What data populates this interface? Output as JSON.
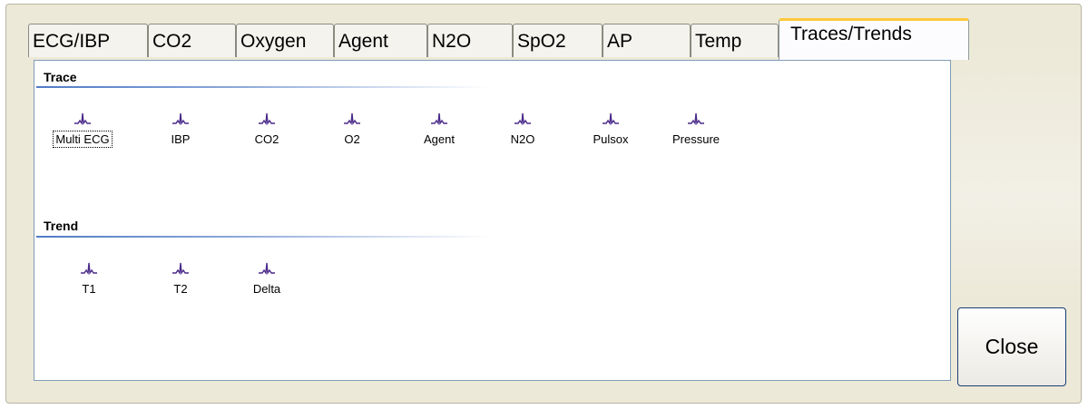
{
  "tabs": [
    {
      "label": "ECG/IBP",
      "active": false
    },
    {
      "label": "CO2",
      "active": false
    },
    {
      "label": "Oxygen",
      "active": false
    },
    {
      "label": "Agent",
      "active": false
    },
    {
      "label": "N2O",
      "active": false
    },
    {
      "label": "SpO2",
      "active": false
    },
    {
      "label": "AP",
      "active": false
    },
    {
      "label": "Temp",
      "active": false
    },
    {
      "label": "Traces/Trends",
      "active": true
    }
  ],
  "trace": {
    "title": "Trace",
    "items": [
      {
        "label": "Multi ECG",
        "icon": "waveform-icon",
        "focused": true
      },
      {
        "label": "IBP",
        "icon": "waveform-icon"
      },
      {
        "label": "CO2",
        "icon": "waveform-icon"
      },
      {
        "label": "O2",
        "icon": "waveform-icon"
      },
      {
        "label": "Agent",
        "icon": "waveform-icon"
      },
      {
        "label": "N2O",
        "icon": "waveform-icon"
      },
      {
        "label": "Pulsox",
        "icon": "waveform-icon"
      },
      {
        "label": "Pressure",
        "icon": "waveform-icon"
      }
    ]
  },
  "trend": {
    "title": "Trend",
    "items": [
      {
        "label": "T1",
        "icon": "waveform-icon"
      },
      {
        "label": "T2",
        "icon": "waveform-icon"
      },
      {
        "label": "Delta",
        "icon": "waveform-icon"
      }
    ]
  },
  "close_label": "Close",
  "colors": {
    "accent_tab": "#ffc83c",
    "icon": "#4a2a8a",
    "section_rule": "#4f7bc5",
    "window": "#ece9d8"
  }
}
